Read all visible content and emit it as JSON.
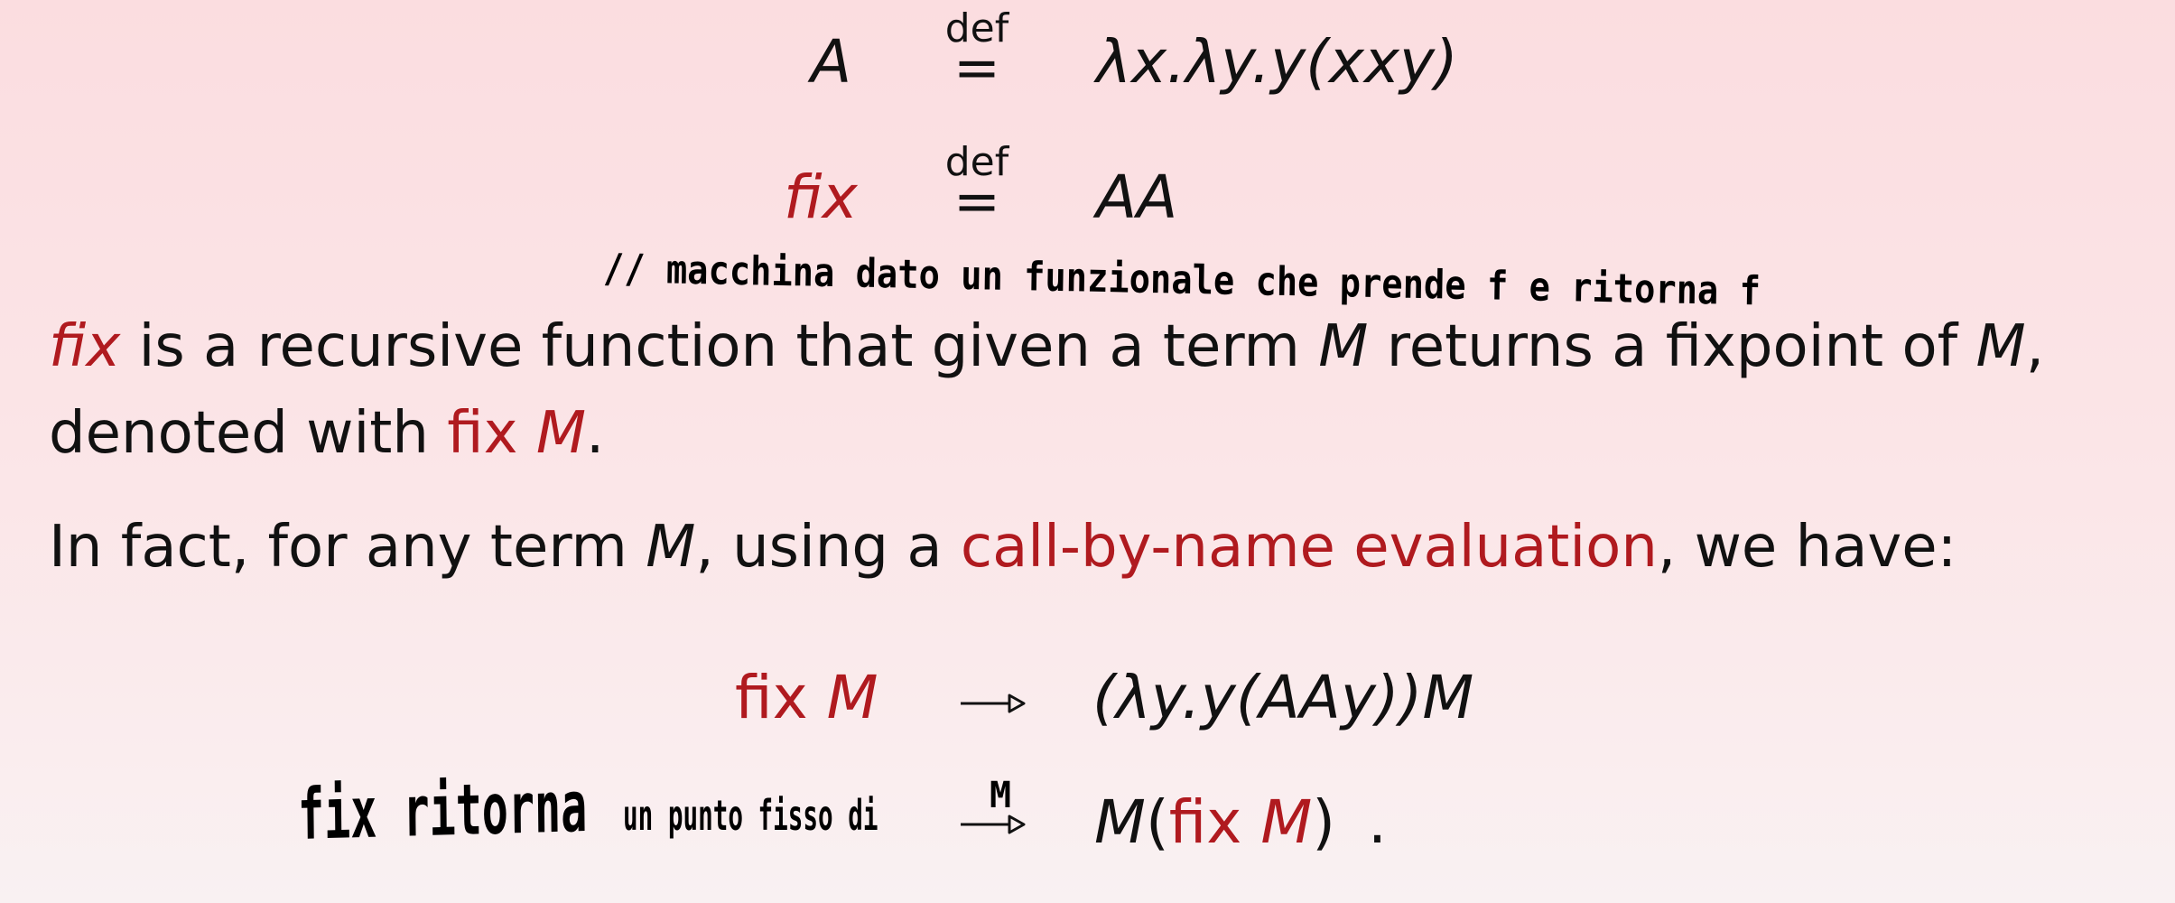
{
  "equations": {
    "a_lhs": "A",
    "def_label": "def",
    "def_eq": "=",
    "a_rhs": "λx.λy.y(xxy)",
    "fix_lhs": "fix",
    "fix_rhs": "AA"
  },
  "handwriting": {
    "note1": "// macchina dato un funzionale che prende f e ritorna f",
    "note2_big": "fix ritorna",
    "note2_small": "un punto fisso di",
    "note2_m": "M"
  },
  "paragraph1": {
    "fix": "fix",
    "text1": " is a recursive function that given a term ",
    "m1": "M",
    "text2": " returns a fixpoint of ",
    "m2": "M",
    "comma": ",",
    "line2_text": "denoted with ",
    "fix_up": "fix",
    "m3": "M",
    "period": "."
  },
  "paragraph2": {
    "text1": "In fact, for any term ",
    "m": "M",
    "text2": ", using a ",
    "highlight": "call-by-name evaluation",
    "text3": ", we have:"
  },
  "reduction": {
    "fix": "fix",
    "m": "M",
    "rhs1": "(λy.y(AAy))M",
    "rhs2_m": "M",
    "rhs2_open": "(",
    "rhs2_fix": "fix",
    "rhs2_m2": "M",
    "rhs2_close": ")",
    "rhs2_dot": "."
  },
  "colors": {
    "accent": "#b01a1f",
    "text": "#111111"
  }
}
